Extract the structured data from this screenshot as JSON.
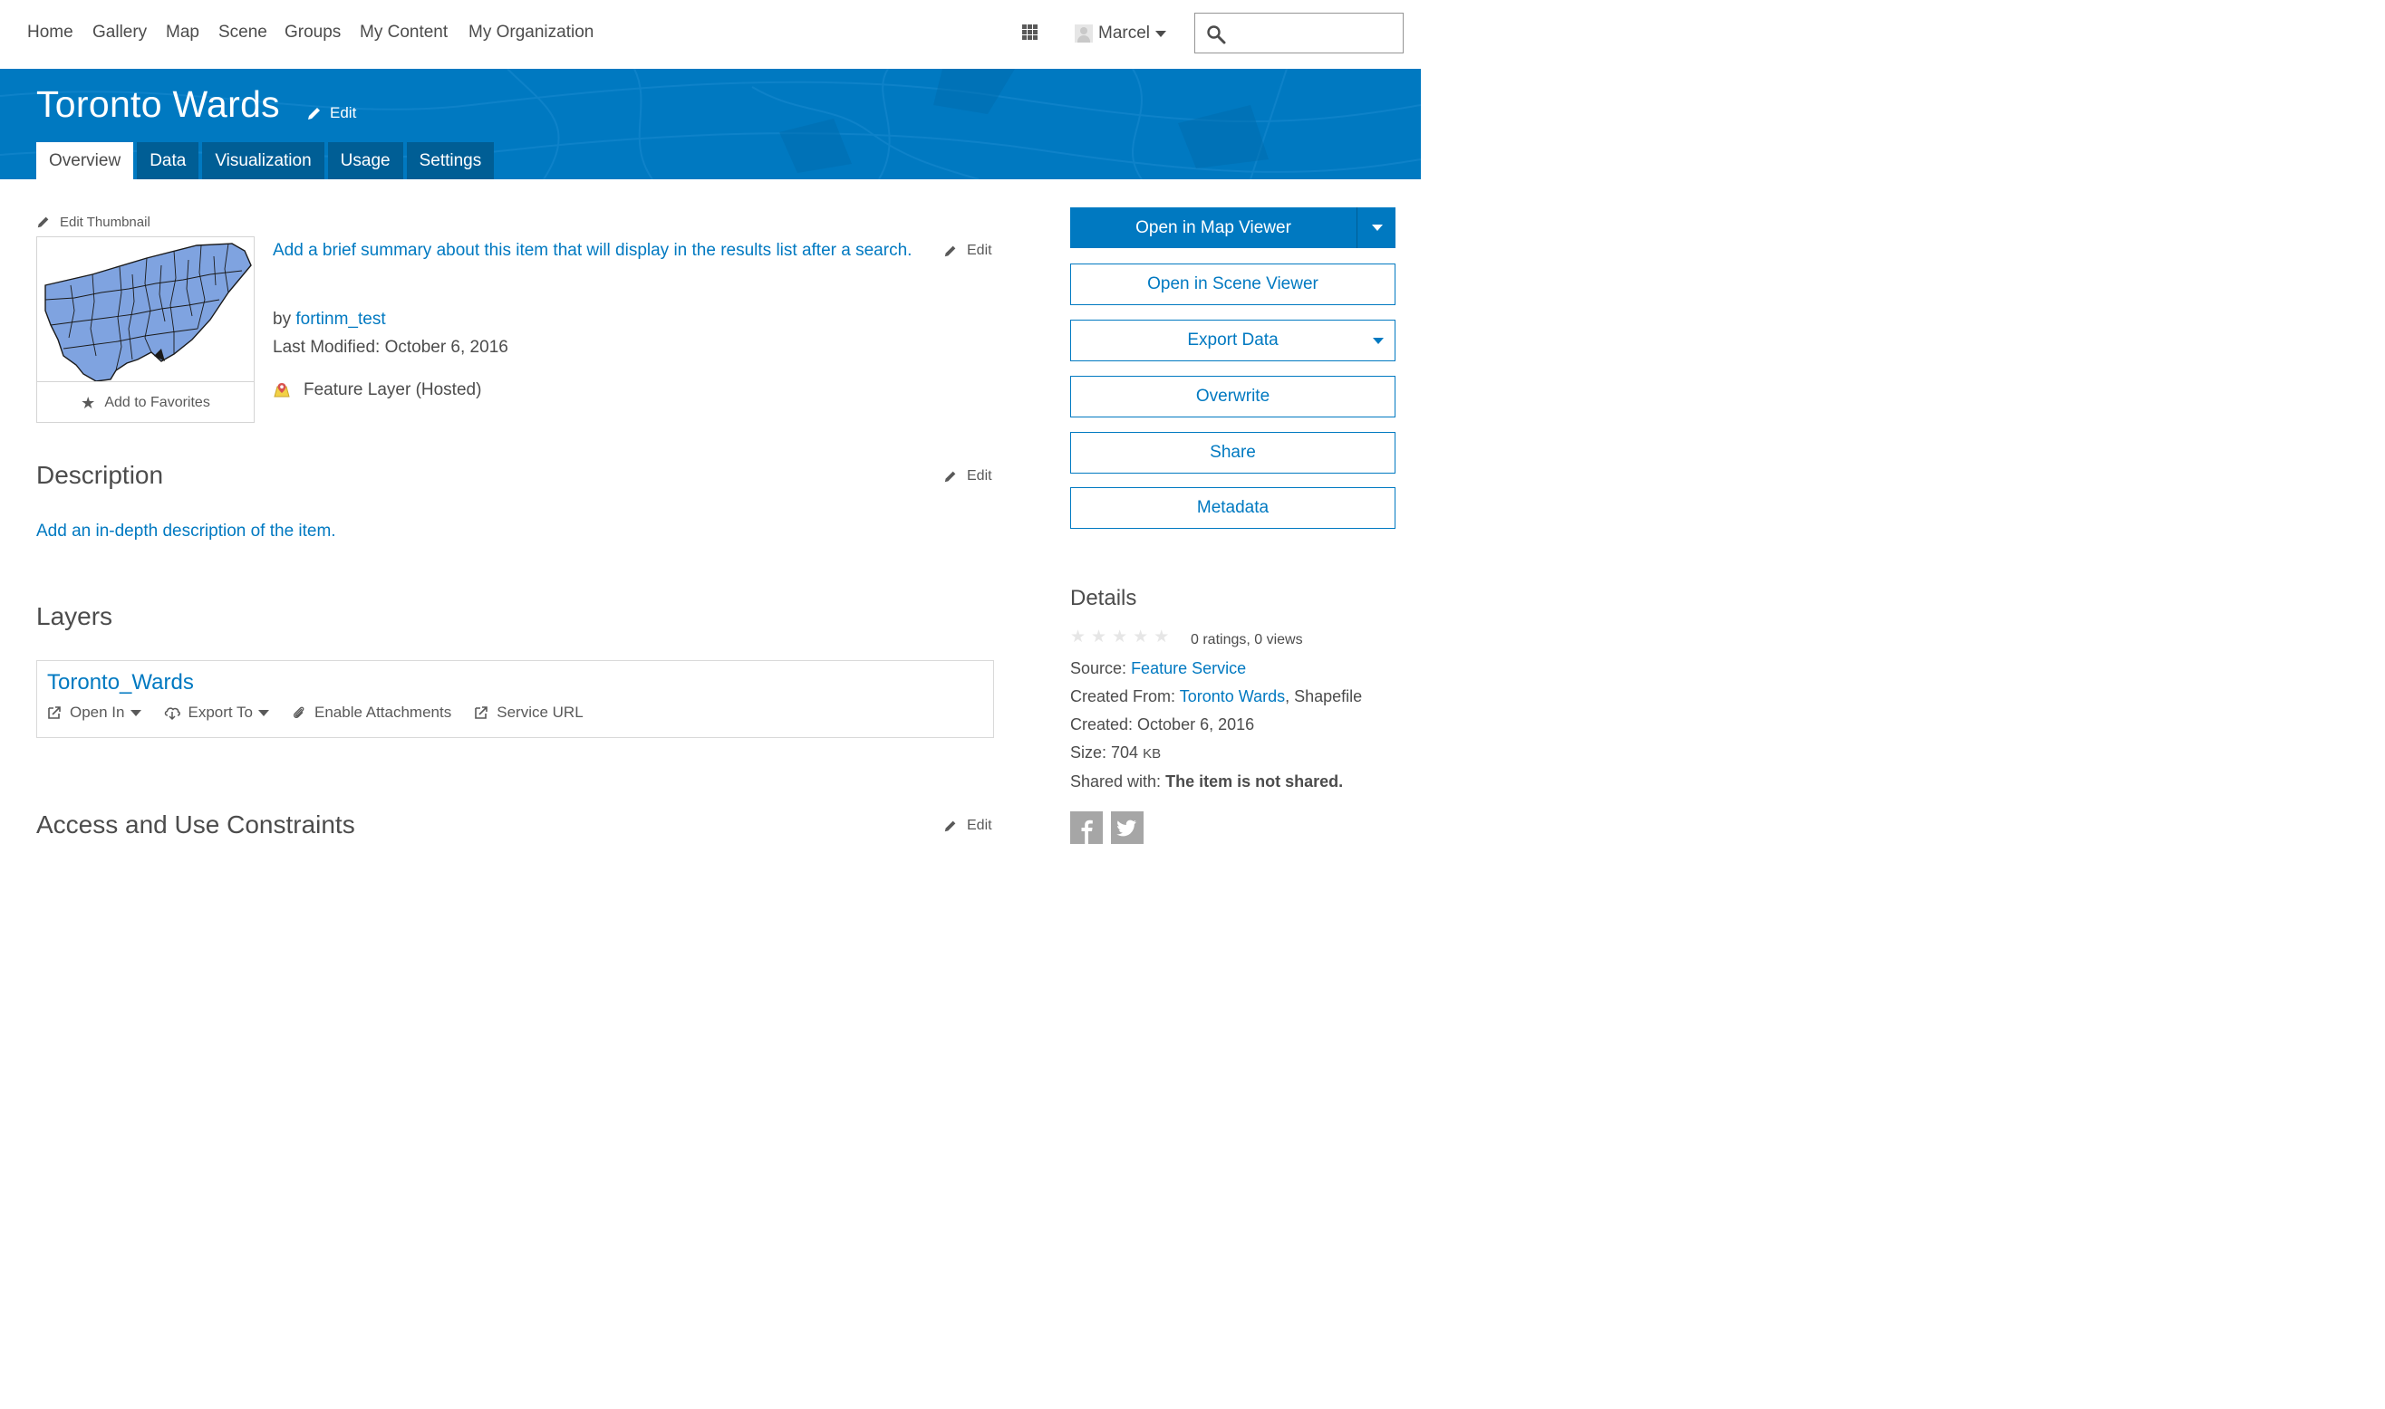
{
  "nav": {
    "links": [
      "Home",
      "Gallery",
      "Map",
      "Scene",
      "Groups",
      "My Content",
      "My Organization"
    ],
    "user_name": "Marcel",
    "search_placeholder": ""
  },
  "header": {
    "title": "Toronto Wards",
    "edit_label": "Edit",
    "tabs": [
      "Overview",
      "Data",
      "Visualization",
      "Usage",
      "Settings"
    ],
    "active_tab": "Overview"
  },
  "overview": {
    "edit_thumbnail_label": "Edit Thumbnail",
    "add_favorites_label": "Add to Favorites",
    "summary_prompt": "Add a brief summary about this item that will display in the results list after a search.",
    "edit_label": "Edit",
    "by_prefix": "by",
    "owner": "fortinm_test",
    "last_modified": "Last Modified: October 6, 2016",
    "item_type": "Feature Layer (Hosted)"
  },
  "description": {
    "title": "Description",
    "edit_label": "Edit",
    "prompt": "Add an in-depth description of the item."
  },
  "layers": {
    "title": "Layers",
    "items": [
      {
        "name": "Toronto_Wards",
        "actions": {
          "open_in": "Open In",
          "export_to": "Export To",
          "enable_attachments": "Enable Attachments",
          "service_url": "Service URL"
        }
      }
    ]
  },
  "constraints": {
    "title": "Access and Use Constraints",
    "edit_label": "Edit"
  },
  "actions": {
    "open_map_viewer": "Open in Map Viewer",
    "open_scene_viewer": "Open in Scene Viewer",
    "export_data": "Export Data",
    "overwrite": "Overwrite",
    "share": "Share",
    "metadata": "Metadata"
  },
  "details": {
    "title": "Details",
    "rating_text": "0 ratings, 0 views",
    "source_label": "Source:",
    "source_value": "Feature Service",
    "created_from_label": "Created From:",
    "created_from_link": "Toronto Wards",
    "created_from_suffix": ", Shapefile",
    "created": "Created: October 6, 2016",
    "size_label": "Size: 704",
    "size_unit": "KB",
    "shared_label": "Shared with:",
    "shared_value": "The item is not shared."
  },
  "colors": {
    "brand_blue": "#0079c1",
    "tab_dark": "#005e95",
    "map_fill": "#7fa3e0"
  },
  "icons": {
    "apps": "apps-grid-icon",
    "search": "search-icon",
    "pencil": "pencil-icon",
    "star": "star-icon",
    "feature_layer": "feature-layer-icon",
    "facebook": "facebook-icon",
    "twitter": "twitter-icon"
  }
}
